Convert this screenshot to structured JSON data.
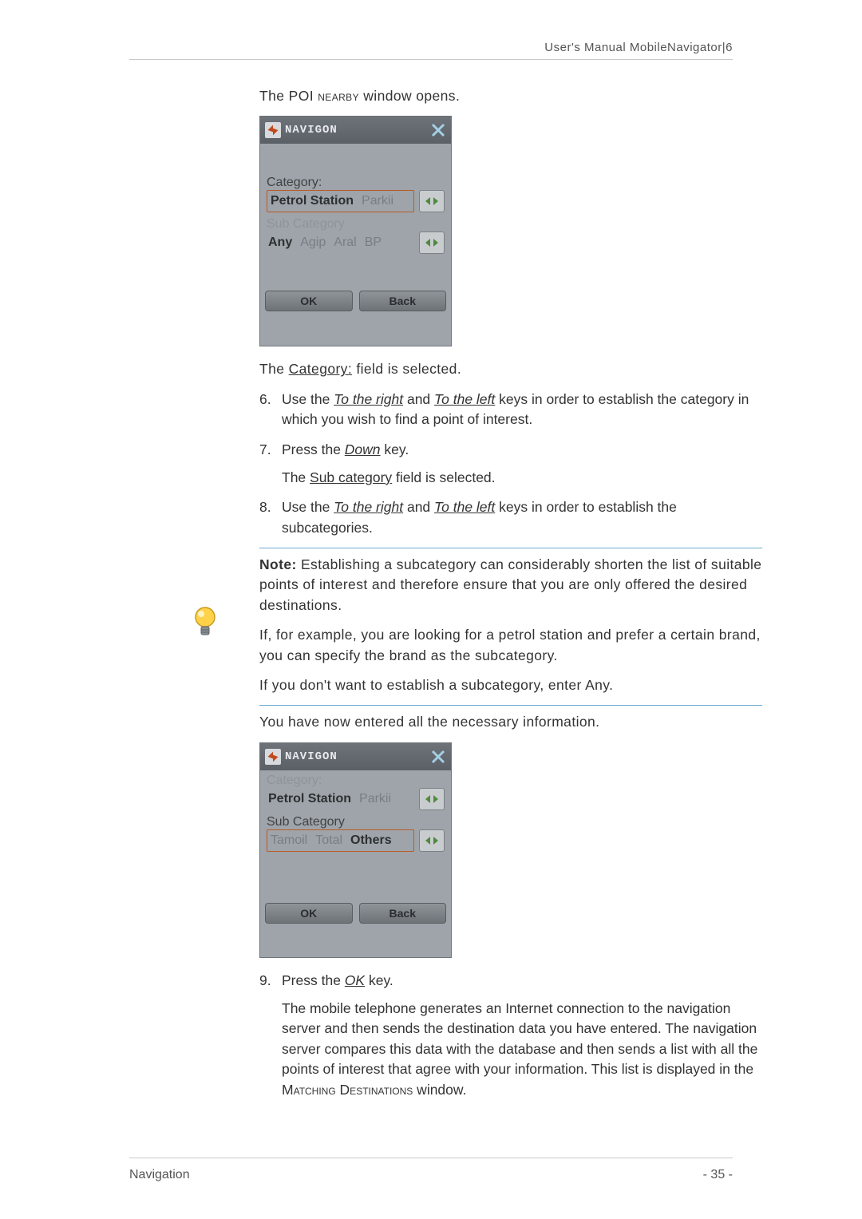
{
  "header": {
    "right": "User's Manual MobileNavigator|6"
  },
  "footer": {
    "left": "Navigation",
    "right": "- 35 -"
  },
  "text": {
    "p1_a": "The POI ",
    "p1_sc": "nearby",
    "p1_b": " window opens.",
    "p2_a": "The ",
    "p2_u": "Category:",
    "p2_b": " field is selected.",
    "step6_a": "Use the ",
    "step6_k1": "To the right",
    "step6_m": " and ",
    "step6_k2": "To the left",
    "step6_b": " keys in order to establish the category in which you wish to find a point of interest.",
    "step7_a": "Press the ",
    "step7_k": "Down",
    "step7_b": " key.",
    "step7_sub_a": "The ",
    "step7_sub_u": "Sub category",
    "step7_sub_b": " field is selected.",
    "step8_a": "Use the ",
    "step8_k1": "To the right",
    "step8_m": " and ",
    "step8_k2": "To the left",
    "step8_b": " keys in order to establish the subcategories.",
    "note_label": "Note:",
    "note1": " Establishing a subcategory can considerably shorten the list of suitable points of interest and therefore ensure that you are only offered the desired destinations.",
    "note2": "If, for example, you are looking for a petrol station and prefer a certain brand, you can specify the brand as the subcategory.",
    "note3": "If you don't want to establish a subcategory, enter Any.",
    "p3": "You have now entered all the necessary information.",
    "step9_a": "Press the ",
    "step9_k": "OK",
    "step9_b": " key.",
    "step9_sub_a": "The mobile telephone generates an Internet connection to the navigation server and then sends the destination data you have entered. The navigation server compares this data with the database and then sends a list with all the points of interest that agree with your information. This list is displayed in the ",
    "step9_sub_sc": "Matching Destinations",
    "step9_sub_b": " window."
  },
  "numbers": {
    "n6": "6.",
    "n7": "7.",
    "n8": "8.",
    "n9": "9."
  },
  "phone1": {
    "brand": "NAVIGON",
    "cat_label": "Category:",
    "cat_items": {
      "sel": "Petrol Station",
      "next": "Parkii"
    },
    "sub_label": "Sub Category",
    "sub_items": {
      "sel": "Any",
      "a": "Agip",
      "b": "Aral",
      "c": "BP"
    },
    "ok": "OK",
    "back": "Back"
  },
  "phone2": {
    "brand": "NAVIGON",
    "cat_label": "Category:",
    "cat_items": {
      "sel": "Petrol Station",
      "next": "Parkii"
    },
    "sub_label": "Sub Category",
    "sub_items": {
      "a": "Tamoil",
      "b": "Total",
      "sel": "Others"
    },
    "ok": "OK",
    "back": "Back"
  }
}
